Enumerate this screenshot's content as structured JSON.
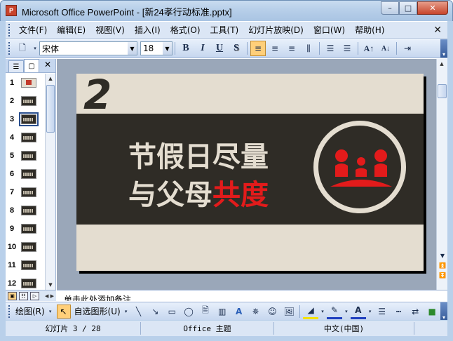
{
  "window": {
    "app_icon": "P",
    "title": "Microsoft Office PowerPoint - [新24孝行动标准.pptx]"
  },
  "menu": [
    "文件(F)",
    "编辑(E)",
    "视图(V)",
    "插入(I)",
    "格式(O)",
    "工具(T)",
    "幻灯片放映(D)",
    "窗口(W)",
    "帮助(H)"
  ],
  "format_toolbar": {
    "font_name": "宋体",
    "font_size": "18",
    "bold": "B",
    "italic": "I",
    "underline": "U",
    "shadow": "S",
    "active_align": "left"
  },
  "thumbnails": {
    "numbers": [
      "1",
      "2",
      "3",
      "4",
      "5",
      "6",
      "7",
      "8",
      "9",
      "10",
      "11",
      "12"
    ],
    "selected": "3"
  },
  "slide": {
    "number": "2",
    "line1": "节假日尽量",
    "line2_prefix": "与父母",
    "line2_highlight": "共度",
    "colors": {
      "dark": "#2f2c26",
      "light": "#e4ddd0",
      "accent": "#e31b1b"
    }
  },
  "notes": {
    "placeholder": "单击此处添加备注"
  },
  "draw_toolbar": {
    "draw_label": "绘图(R)",
    "autoshapes_label": "自选图形(U)"
  },
  "status": {
    "slide_counter": "幻灯片 3 / 28",
    "theme": "Office 主题",
    "language": "中文(中国)"
  }
}
